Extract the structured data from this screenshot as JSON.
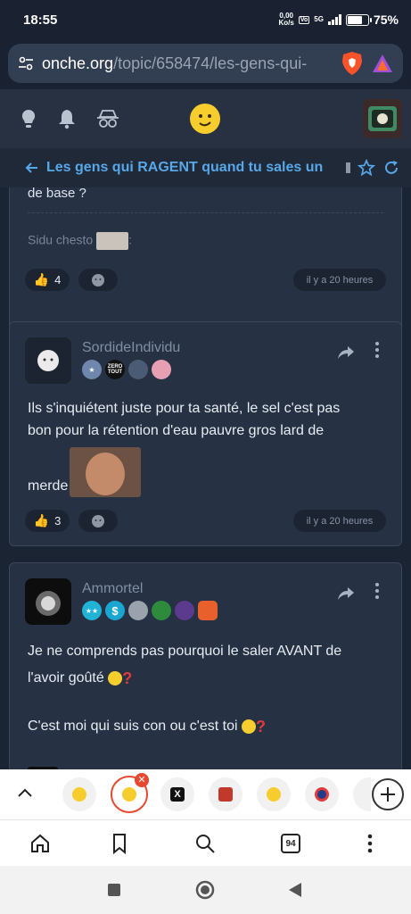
{
  "status": {
    "time": "18:55",
    "net_speed": "0,00",
    "net_unit": "Ko/s",
    "network": "5G",
    "battery_pct": "75%"
  },
  "browser": {
    "url_domain": "onche.org",
    "url_path": "/topic/658474/les-gens-qui-"
  },
  "topic": {
    "title": "Les gens qui RAGENT quand tu sales un"
  },
  "posts": [
    {
      "tail_text": "de base ?",
      "signature": "Sidu chesto",
      "likes": "4",
      "time": "il y a 20 heures"
    },
    {
      "author": "SordideIndividu",
      "text_line1": "Ils s'inquiétent juste pour ta santé, le sel c'est pas",
      "text_line2": "bon pour la rétention d'eau pauvre gros lard de",
      "text_line3": "merde",
      "badge_zero": "ZERO",
      "badge_tout": "TOUT",
      "likes": "3",
      "time": "il y a 20 heures"
    },
    {
      "author": "Ammortel",
      "text_line1": "Je ne comprends pas pourquoi le saler AVANT de",
      "text_line2": "l'avoir goûté",
      "text_line3": "C'est moi qui suis con ou c'est toi"
    }
  ],
  "tabs": {
    "count": "94"
  },
  "colors": {
    "accent": "#58a7e8",
    "card": "#263143",
    "danger": "#e8482f"
  }
}
